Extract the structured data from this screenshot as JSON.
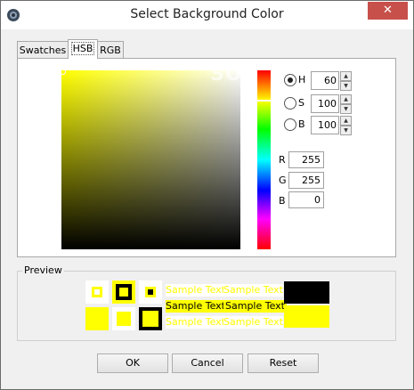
{
  "window": {
    "title": "Select Background Color",
    "close_glyph": "✕"
  },
  "tabs": [
    {
      "label": "Swatches",
      "active": false
    },
    {
      "label": "HSB",
      "active": true
    },
    {
      "label": "RGB",
      "active": false
    }
  ],
  "watermark": "SOFTPEDIA",
  "hsb": {
    "h": {
      "label": "H",
      "value": "60",
      "selected": true
    },
    "s": {
      "label": "S",
      "value": "100",
      "selected": false
    },
    "b": {
      "label": "B",
      "value": "100",
      "selected": false
    }
  },
  "rgb": {
    "r": {
      "label": "R",
      "value": "255"
    },
    "g": {
      "label": "G",
      "value": "255"
    },
    "b": {
      "label": "B",
      "value": "0"
    }
  },
  "preview": {
    "title": "Preview",
    "sample_text": "Sample Text"
  },
  "buttons": {
    "ok": "OK",
    "cancel": "Cancel",
    "reset": "Reset"
  },
  "colors": {
    "selected": "#ffff00",
    "accent_close": "#c7504a"
  }
}
